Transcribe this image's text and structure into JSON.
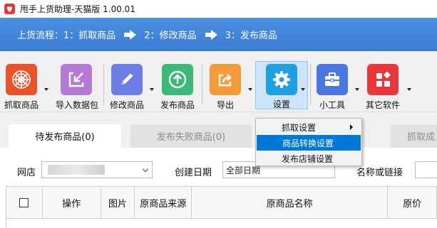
{
  "window": {
    "title": "甩手上货助理-天猫版 1.00.01",
    "logo_color": "#e8383d"
  },
  "flow": {
    "label": "上货流程：",
    "steps": [
      "1：抓取商品",
      "2：修改商品",
      "3：发布商品"
    ],
    "bar_color": "#4287dc"
  },
  "toolbar": {
    "items": [
      {
        "label": "抓取商品",
        "icon": "spider-web-icon",
        "color": "#e8542a"
      },
      {
        "label": "导入数据包",
        "icon": "import-package-icon",
        "color": "#b77ad4"
      },
      {
        "label": "修改商品",
        "icon": "pencil-icon",
        "color": "#6d7fe6"
      },
      {
        "label": "发布商品",
        "icon": "upload-circle-icon",
        "color": "#3cb878"
      },
      {
        "label": "导出",
        "icon": "export-share-icon",
        "color": "#f39b3a"
      },
      {
        "label": "设置",
        "icon": "gear-icon",
        "color": "#1fa0e0"
      },
      {
        "label": "小工具",
        "icon": "toolbox-icon",
        "color": "#4a78e0"
      },
      {
        "label": "其它软件",
        "icon": "apps-grid-icon",
        "color": "#e8383d"
      }
    ]
  },
  "tabs": [
    {
      "label": "待发布商品(0)",
      "state": "active"
    },
    {
      "label": "发布失败商品(0)",
      "state": "inactive"
    },
    {
      "label": "抓取成",
      "state": "inactive"
    }
  ],
  "filters": {
    "shop_label": "网店",
    "shop_value": "",
    "date_label": "创建日期",
    "date_value": "全部日期",
    "name_label": "名称或链接",
    "name_value": ""
  },
  "table": {
    "columns": [
      "",
      "操作",
      "图片",
      "原商品来源",
      "原商品名称",
      "原价"
    ]
  },
  "settings_menu": {
    "items": [
      {
        "label": "抓取设置",
        "has_submenu": true
      },
      {
        "label": "商品转换设置",
        "highlighted": true
      },
      {
        "label": "发布店铺设置"
      }
    ]
  }
}
